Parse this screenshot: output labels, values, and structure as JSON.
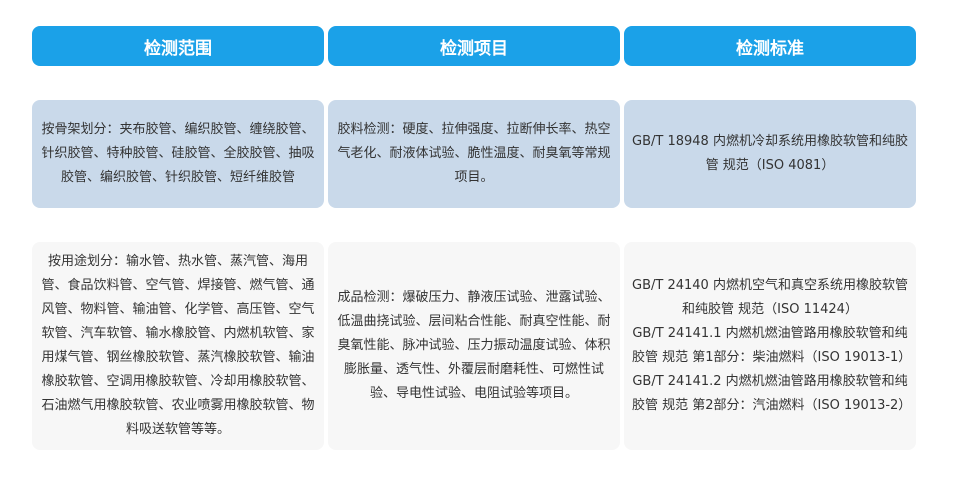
{
  "headers": [
    "检测范围",
    "检测项目",
    "检测标准"
  ],
  "rows": [
    {
      "scope": "按骨架划分：夹布胶管、编织胶管、缠绕胶管、针织胶管、特种胶管、硅胶管、全胶胶管、抽吸胶管、编织胶管、针织胶管、短纤维胶管",
      "items": "胶料检测：硬度、拉伸强度、拉断伸长率、热空气老化、耐液体试验、脆性温度、耐臭氧等常规项目。",
      "standards": [
        "GB/T 18948 内燃机冷却系统用橡胶软管和纯胶管 规范（ISO 4081）"
      ]
    },
    {
      "scope": "按用途划分：输水管、热水管、蒸汽管、海用管、食品饮料管、空气管、焊接管、燃气管、通风管、物料管、输油管、化学管、高压管、空气软管、汽车软管、输水橡胶管、内燃机软管、家用煤气管、钢丝橡胶软管、蒸汽橡胶软管、输油橡胶软管、空调用橡胶软管、冷却用橡胶软管、石油燃气用橡胶软管、农业喷雾用橡胶软管、物料吸送软管等等。",
      "items": "成品检测：爆破压力、静液压试验、泄露试验、低温曲挠试验、层间粘合性能、耐真空性能、耐臭氧性能、脉冲试验、压力振动温度试验、体积膨胀量、透气性、外覆层耐磨耗性、可燃性试验、导电性试验、电阻试验等项目。",
      "standards": [
        "GB/T 24140 内燃机空气和真空系统用橡胶软管和纯胶管 规范（ISO 11424）",
        "GB/T 24141.1 内燃机燃油管路用橡胶软管和纯胶管 规范 第1部分：柴油燃料（ISO 19013-1）",
        "GB/T 24141.2 内燃机燃油管路用橡胶软管和纯胶管 规范 第2部分：汽油燃料（ISO 19013-2）"
      ]
    }
  ]
}
